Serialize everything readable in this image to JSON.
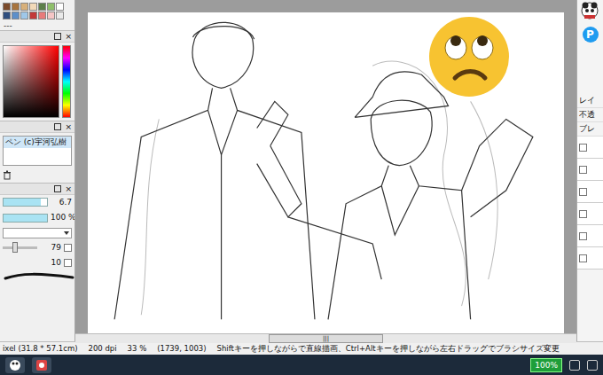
{
  "palette": {
    "colors": [
      "#7b4a2a",
      "#a8743e",
      "#d8b07a",
      "#f2d9b8",
      "#5c7f4a",
      "#8fbf6a",
      "#ffffff",
      "#2f4f7f",
      "#5d8fc9",
      "#9fc7e8",
      "#c23a3a",
      "#e87a7a",
      "#f5c6c6",
      "#e9e9e9"
    ]
  },
  "palette_sep": "---",
  "color_pane": {
    "close": "×"
  },
  "brush_pane": {
    "close": "×",
    "items": [
      {
        "label": "ペン (c)宇河弘樹",
        "selected": true
      }
    ]
  },
  "tool_pane": {
    "close": "×",
    "size": {
      "reading": "6.7",
      "level": 0.85
    },
    "opacity": {
      "reading": "100 %",
      "level": 1
    },
    "density": {
      "reading": "79",
      "level": 0.35,
      "checked": false
    },
    "extra": {
      "reading": "10",
      "checked": false
    }
  },
  "canvas": {
    "scroll_grip": "|||"
  },
  "right_pane": {
    "badge": "P",
    "layer_labels": [
      "レイ",
      "不透",
      "ブレ"
    ]
  },
  "status_bar": {
    "size": "ixel (31.8 * 57.1cm)",
    "dpi": "200 dpi",
    "zoom": "33 %",
    "cursor": "(1739, 1003)",
    "hint": "Shiftキーを押しながらで直線描画、Ctrl+Altキーを押しながら左右ドラッグでブラシサイズ変更"
  },
  "taskbar": {
    "battery": "100%"
  }
}
